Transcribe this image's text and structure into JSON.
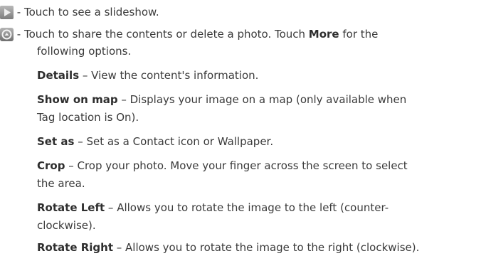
{
  "items": [
    {
      "icon": "play-icon",
      "lead": " - ",
      "text": "Touch to see a slideshow."
    },
    {
      "icon": "menu-circle-icon",
      "lead": " - ",
      "text_before": "Touch to share the contents or delete a photo. Touch ",
      "bold": "More",
      "text_after": " for the",
      "continuation": "following options."
    }
  ],
  "options": [
    {
      "term": "Details",
      "desc": " – View the content's information.",
      "cont": ""
    },
    {
      "term": "Show on map",
      "desc": " – Displays your image on a map (only available when",
      "cont": "Tag location is On)."
    },
    {
      "term": "Set as",
      "desc": " – Set as a Contact icon or Wallpaper.",
      "cont": ""
    },
    {
      "term": "Crop",
      "desc": " – Crop your photo. Move your finger across the screen to select",
      "cont": "the area."
    },
    {
      "term": "Rotate Left",
      "desc": " – Allows you to rotate the image to the left (counter-",
      "cont": "clockwise)."
    },
    {
      "term": "Rotate Right",
      "desc": " – Allows you to rotate the image to the right (clockwise).",
      "cont": ""
    }
  ]
}
